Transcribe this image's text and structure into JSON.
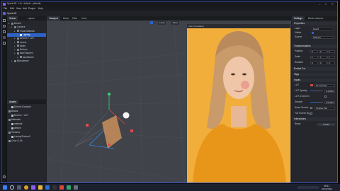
{
  "app": {
    "title": "Spark AR - Lift - default - (default)",
    "menu": [
      "File",
      "Edit",
      "View",
      "Add",
      "Project",
      "Help"
    ],
    "project_name": "Spark AR"
  },
  "scene_panel": {
    "tabs": [
      "Scene",
      "Layers"
    ],
    "tree": [
      {
        "label": "Device",
        "depth": 0,
        "selected": false
      },
      {
        "label": "Camera",
        "depth": 1,
        "selected": false
      },
      {
        "label": "Focal Distance",
        "depth": 2,
        "selected": false
      },
      {
        "label": "Lightbg",
        "depth": 3,
        "selected": true
      },
      {
        "label": "Deform + LUT",
        "depth": 2,
        "selected": false
      },
      {
        "label": "Levels",
        "depth": 2,
        "selected": false
      },
      {
        "label": "Mode",
        "depth": 2,
        "selected": false
      },
      {
        "label": "Deform",
        "depth": 2,
        "selected": false
      },
      {
        "label": "faceTracker0",
        "depth": 2,
        "selected": false
      },
      {
        "label": "faceMesh0",
        "depth": 3,
        "selected": false
      },
      {
        "label": "Microphone",
        "depth": 1,
        "selected": false
      }
    ]
  },
  "assets_panel": {
    "title": "Assets",
    "items": [
      {
        "label": "Deform Example",
        "depth": 1
      },
      {
        "label": "Blocks",
        "depth": 0
      },
      {
        "label": "Deform + LUT",
        "depth": 1
      },
      {
        "label": "Materials",
        "depth": 0
      },
      {
        "label": "material",
        "depth": 1
      },
      {
        "label": "deform",
        "depth": 1
      },
      {
        "label": "Textures",
        "depth": 0
      },
      {
        "label": "LookupTexture0",
        "depth": 1
      },
      {
        "label": "Color LUTs",
        "depth": 0
      }
    ]
  },
  "viewport": {
    "tabs": [
      "Viewport",
      "Block",
      "Filter",
      "View"
    ],
    "toolbar_buttons": [
      "Local",
      "Pivot"
    ],
    "preview_label": "User (Simulator)"
  },
  "inspector": {
    "tab_left": "Settings",
    "tab_right": "Block Instance",
    "header": "Settings - Block Instance",
    "properties_label": "Properties",
    "layer_label": "Layer",
    "layer_value": "layer0",
    "visible_label": "Visible",
    "source_label": "Source",
    "source_value": "Settings",
    "transformations_label": "Transformations",
    "position_label": "Position",
    "scale_label": "Scale",
    "rotation_label": "Rotation",
    "enable_for_label": "Enable For",
    "tags_label": "Tags",
    "inputs_label": "Inputs",
    "lut_label": "LUT",
    "lut_value": "lut.example",
    "lut_opacity_label": "LUT Opacity",
    "lut_opacity_value": "0.44000",
    "lut_screen_label": "LUT to Screen",
    "smooth_label": "Smooth",
    "smooth_value": "0.51000",
    "noise_label": "Noise Texture",
    "noise_value": "Choose File",
    "full_screen_label": "Full Screen Bg",
    "interactions_label": "Interactions",
    "reset_label": "Reset",
    "create_label": "Create",
    "pos_values": [
      "0",
      "0",
      "0"
    ],
    "scale_values": [
      "1",
      "1",
      "1"
    ],
    "rot_values": [
      "0",
      "0",
      "0"
    ],
    "lut_opacity_fraction": 0.44,
    "smooth_fraction": 0.51
  },
  "taskbar": {
    "time": "09:41",
    "date": "01/01/2024",
    "icons": [
      "start-icon",
      "search-icon",
      "taskview-icon",
      "chrome-icon",
      "spark-icon",
      "explorer-icon",
      "photoshop-icon",
      "terminal-icon",
      "app-icon",
      "app2-icon",
      "app3-icon"
    ]
  },
  "colors": {
    "accent": "#2e62c8",
    "window_border": "#3a5bd9",
    "photo_bg": "#f2ae3a",
    "sweater": "#e8961a",
    "hair": "#c99a6a"
  }
}
